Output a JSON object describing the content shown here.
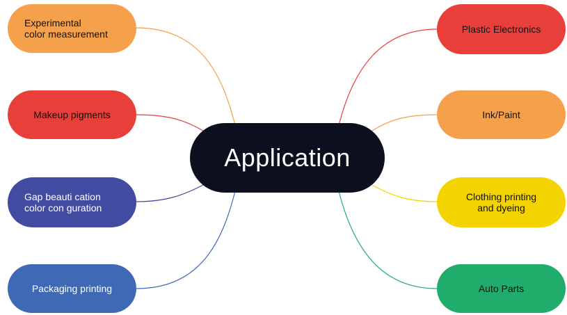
{
  "center_label": "Application",
  "left_nodes": [
    {
      "label": "Experimental\ncolor measurement",
      "color": "#f5a04a",
      "line_color": "#f5a04a"
    },
    {
      "label": "Makeup pigments",
      "color": "#e83f3a",
      "line_color": "#e83f3a"
    },
    {
      "label": "Gap beauti    cation\ncolor con    guration",
      "color": "#414ca0",
      "line_color": "#414ca0"
    },
    {
      "label": "Packaging printing",
      "color": "#3f69b4",
      "line_color": "#3f69b4"
    }
  ],
  "right_nodes": [
    {
      "label": "Plastic Electronics",
      "color": "#e83f3a",
      "line_color": "#e83f3a"
    },
    {
      "label": "Ink/Paint",
      "color": "#f5a04a",
      "line_color": "#f5a04a"
    },
    {
      "label": "Clothing printing\nand dyeing",
      "color": "#f3d400",
      "line_color": "#f3d400"
    },
    {
      "label": "Auto Parts",
      "color": "#20ac6a",
      "line_color": "#20ac6a"
    }
  ]
}
